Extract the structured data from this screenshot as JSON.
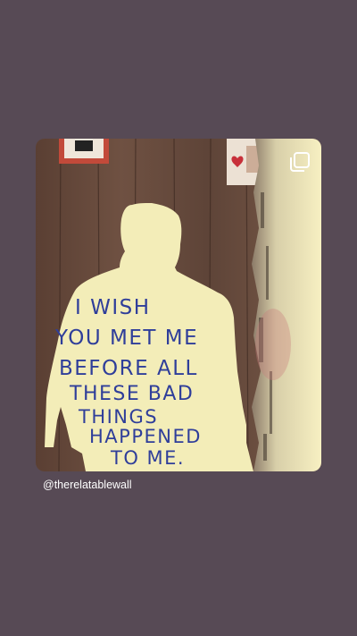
{
  "story": {
    "username": "@therelatablewall",
    "post": {
      "handwritten_lines": [
        "I WISH",
        "YOU MET ME",
        "BEFORE ALL",
        "THESE BAD",
        "THINGS",
        "HAPPENED",
        "TO ME."
      ],
      "ink_color": "#2f3e9a",
      "paper_color": "#f3edb8"
    },
    "icons": {
      "multi_post": "multiple-photos-icon"
    },
    "colors": {
      "background": "#574a55"
    }
  }
}
